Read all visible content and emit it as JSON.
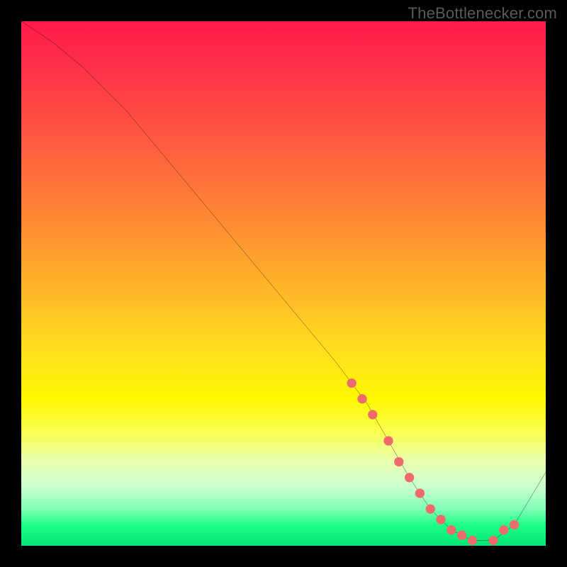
{
  "attribution": "TheBottlenecker.com",
  "chart_data": {
    "type": "line",
    "title": "",
    "xlabel": "",
    "ylabel": "",
    "xlim": [
      0,
      100
    ],
    "ylim": [
      0,
      100
    ],
    "series": [
      {
        "name": "bottleneck-curve",
        "x": [
          0,
          6,
          12,
          20,
          30,
          40,
          50,
          60,
          66,
          70,
          74,
          78,
          82,
          86,
          90,
          94,
          100
        ],
        "y": [
          100,
          96,
          91,
          83,
          71,
          59,
          47,
          35,
          27,
          20,
          13,
          7,
          3,
          1,
          1,
          4,
          14
        ]
      }
    ],
    "markers": {
      "name": "highlighted-points",
      "x": [
        63,
        65,
        67,
        70,
        72,
        74,
        76,
        78,
        80,
        82,
        84,
        86,
        90,
        92,
        94
      ],
      "y": [
        31,
        28,
        25,
        20,
        16,
        13,
        10,
        7,
        5,
        3,
        2,
        1,
        1,
        3,
        4
      ]
    },
    "background": {
      "type": "vertical-gradient",
      "stops": [
        {
          "pos": 0,
          "color": "#ff1a4b"
        },
        {
          "pos": 64,
          "color": "#ffe31c"
        },
        {
          "pos": 100,
          "color": "#00e676"
        }
      ]
    }
  }
}
